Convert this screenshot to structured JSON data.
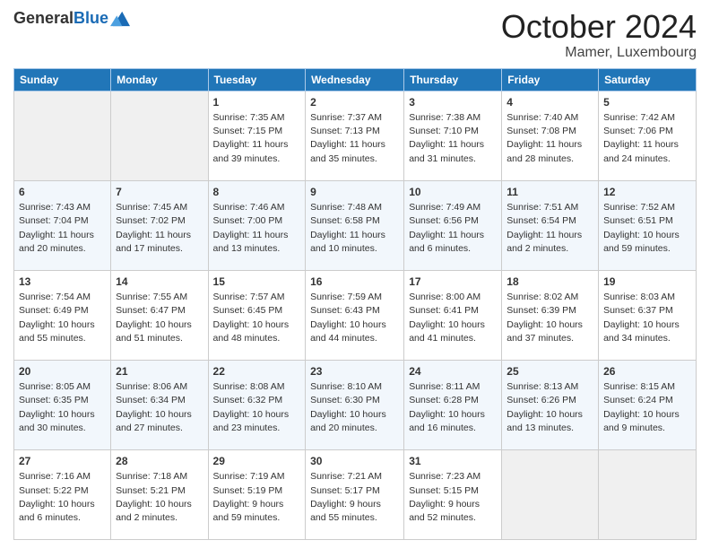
{
  "logo": {
    "line1": "General",
    "line2": "Blue"
  },
  "title": "October 2024",
  "subtitle": "Mamer, Luxembourg",
  "days_of_week": [
    "Sunday",
    "Monday",
    "Tuesday",
    "Wednesday",
    "Thursday",
    "Friday",
    "Saturday"
  ],
  "weeks": [
    [
      {
        "day": "",
        "empty": true
      },
      {
        "day": "",
        "empty": true
      },
      {
        "day": "1",
        "sunrise": "Sunrise: 7:35 AM",
        "sunset": "Sunset: 7:15 PM",
        "daylight": "Daylight: 11 hours and 39 minutes."
      },
      {
        "day": "2",
        "sunrise": "Sunrise: 7:37 AM",
        "sunset": "Sunset: 7:13 PM",
        "daylight": "Daylight: 11 hours and 35 minutes."
      },
      {
        "day": "3",
        "sunrise": "Sunrise: 7:38 AM",
        "sunset": "Sunset: 7:10 PM",
        "daylight": "Daylight: 11 hours and 31 minutes."
      },
      {
        "day": "4",
        "sunrise": "Sunrise: 7:40 AM",
        "sunset": "Sunset: 7:08 PM",
        "daylight": "Daylight: 11 hours and 28 minutes."
      },
      {
        "day": "5",
        "sunrise": "Sunrise: 7:42 AM",
        "sunset": "Sunset: 7:06 PM",
        "daylight": "Daylight: 11 hours and 24 minutes."
      }
    ],
    [
      {
        "day": "6",
        "sunrise": "Sunrise: 7:43 AM",
        "sunset": "Sunset: 7:04 PM",
        "daylight": "Daylight: 11 hours and 20 minutes."
      },
      {
        "day": "7",
        "sunrise": "Sunrise: 7:45 AM",
        "sunset": "Sunset: 7:02 PM",
        "daylight": "Daylight: 11 hours and 17 minutes."
      },
      {
        "day": "8",
        "sunrise": "Sunrise: 7:46 AM",
        "sunset": "Sunset: 7:00 PM",
        "daylight": "Daylight: 11 hours and 13 minutes."
      },
      {
        "day": "9",
        "sunrise": "Sunrise: 7:48 AM",
        "sunset": "Sunset: 6:58 PM",
        "daylight": "Daylight: 11 hours and 10 minutes."
      },
      {
        "day": "10",
        "sunrise": "Sunrise: 7:49 AM",
        "sunset": "Sunset: 6:56 PM",
        "daylight": "Daylight: 11 hours and 6 minutes."
      },
      {
        "day": "11",
        "sunrise": "Sunrise: 7:51 AM",
        "sunset": "Sunset: 6:54 PM",
        "daylight": "Daylight: 11 hours and 2 minutes."
      },
      {
        "day": "12",
        "sunrise": "Sunrise: 7:52 AM",
        "sunset": "Sunset: 6:51 PM",
        "daylight": "Daylight: 10 hours and 59 minutes."
      }
    ],
    [
      {
        "day": "13",
        "sunrise": "Sunrise: 7:54 AM",
        "sunset": "Sunset: 6:49 PM",
        "daylight": "Daylight: 10 hours and 55 minutes."
      },
      {
        "day": "14",
        "sunrise": "Sunrise: 7:55 AM",
        "sunset": "Sunset: 6:47 PM",
        "daylight": "Daylight: 10 hours and 51 minutes."
      },
      {
        "day": "15",
        "sunrise": "Sunrise: 7:57 AM",
        "sunset": "Sunset: 6:45 PM",
        "daylight": "Daylight: 10 hours and 48 minutes."
      },
      {
        "day": "16",
        "sunrise": "Sunrise: 7:59 AM",
        "sunset": "Sunset: 6:43 PM",
        "daylight": "Daylight: 10 hours and 44 minutes."
      },
      {
        "day": "17",
        "sunrise": "Sunrise: 8:00 AM",
        "sunset": "Sunset: 6:41 PM",
        "daylight": "Daylight: 10 hours and 41 minutes."
      },
      {
        "day": "18",
        "sunrise": "Sunrise: 8:02 AM",
        "sunset": "Sunset: 6:39 PM",
        "daylight": "Daylight: 10 hours and 37 minutes."
      },
      {
        "day": "19",
        "sunrise": "Sunrise: 8:03 AM",
        "sunset": "Sunset: 6:37 PM",
        "daylight": "Daylight: 10 hours and 34 minutes."
      }
    ],
    [
      {
        "day": "20",
        "sunrise": "Sunrise: 8:05 AM",
        "sunset": "Sunset: 6:35 PM",
        "daylight": "Daylight: 10 hours and 30 minutes."
      },
      {
        "day": "21",
        "sunrise": "Sunrise: 8:06 AM",
        "sunset": "Sunset: 6:34 PM",
        "daylight": "Daylight: 10 hours and 27 minutes."
      },
      {
        "day": "22",
        "sunrise": "Sunrise: 8:08 AM",
        "sunset": "Sunset: 6:32 PM",
        "daylight": "Daylight: 10 hours and 23 minutes."
      },
      {
        "day": "23",
        "sunrise": "Sunrise: 8:10 AM",
        "sunset": "Sunset: 6:30 PM",
        "daylight": "Daylight: 10 hours and 20 minutes."
      },
      {
        "day": "24",
        "sunrise": "Sunrise: 8:11 AM",
        "sunset": "Sunset: 6:28 PM",
        "daylight": "Daylight: 10 hours and 16 minutes."
      },
      {
        "day": "25",
        "sunrise": "Sunrise: 8:13 AM",
        "sunset": "Sunset: 6:26 PM",
        "daylight": "Daylight: 10 hours and 13 minutes."
      },
      {
        "day": "26",
        "sunrise": "Sunrise: 8:15 AM",
        "sunset": "Sunset: 6:24 PM",
        "daylight": "Daylight: 10 hours and 9 minutes."
      }
    ],
    [
      {
        "day": "27",
        "sunrise": "Sunrise: 7:16 AM",
        "sunset": "Sunset: 5:22 PM",
        "daylight": "Daylight: 10 hours and 6 minutes."
      },
      {
        "day": "28",
        "sunrise": "Sunrise: 7:18 AM",
        "sunset": "Sunset: 5:21 PM",
        "daylight": "Daylight: 10 hours and 2 minutes."
      },
      {
        "day": "29",
        "sunrise": "Sunrise: 7:19 AM",
        "sunset": "Sunset: 5:19 PM",
        "daylight": "Daylight: 9 hours and 59 minutes."
      },
      {
        "day": "30",
        "sunrise": "Sunrise: 7:21 AM",
        "sunset": "Sunset: 5:17 PM",
        "daylight": "Daylight: 9 hours and 55 minutes."
      },
      {
        "day": "31",
        "sunrise": "Sunrise: 7:23 AM",
        "sunset": "Sunset: 5:15 PM",
        "daylight": "Daylight: 9 hours and 52 minutes."
      },
      {
        "day": "",
        "empty": true
      },
      {
        "day": "",
        "empty": true
      }
    ]
  ]
}
